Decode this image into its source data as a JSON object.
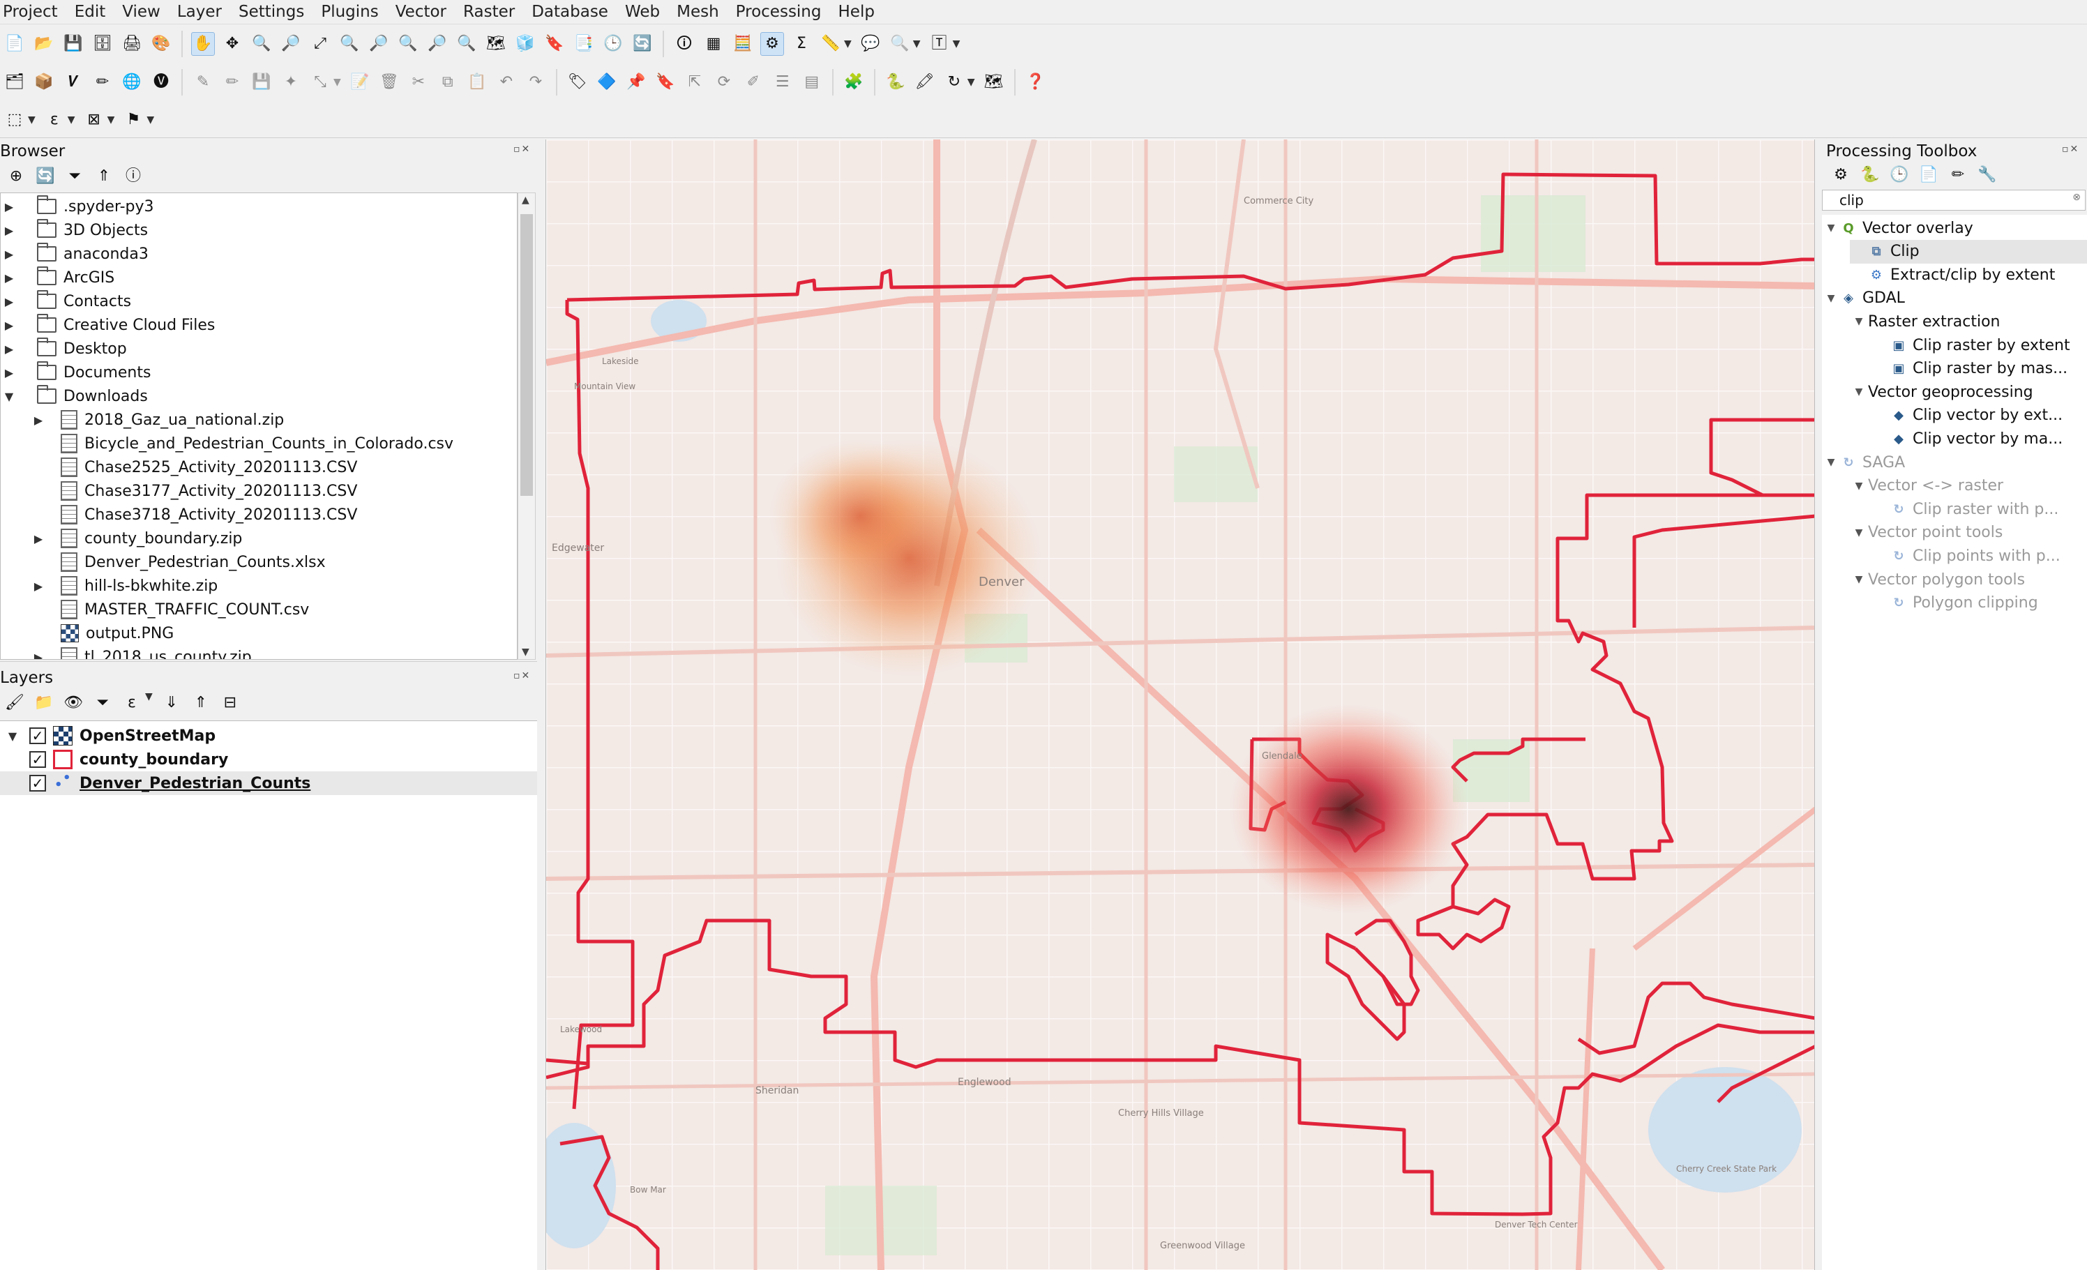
{
  "menu": [
    "Project",
    "Edit",
    "View",
    "Layer",
    "Settings",
    "Plugins",
    "Vector",
    "Raster",
    "Database",
    "Web",
    "Mesh",
    "Processing",
    "Help"
  ],
  "browser": {
    "title": "Browser",
    "items": [
      {
        "label": ".spyder-py3",
        "kind": "folder",
        "expanded": false
      },
      {
        "label": "3D Objects",
        "kind": "folder",
        "expanded": false
      },
      {
        "label": "anaconda3",
        "kind": "folder",
        "expanded": false
      },
      {
        "label": "ArcGIS",
        "kind": "folder",
        "expanded": false
      },
      {
        "label": "Contacts",
        "kind": "folder",
        "expanded": false
      },
      {
        "label": "Creative Cloud Files",
        "kind": "folder",
        "expanded": false
      },
      {
        "label": "Desktop",
        "kind": "folder",
        "expanded": false
      },
      {
        "label": "Documents",
        "kind": "folder",
        "expanded": false
      },
      {
        "label": "Downloads",
        "kind": "folder",
        "expanded": true
      },
      {
        "label": "2018_Gaz_ua_national.zip",
        "kind": "zip",
        "expanded": false
      },
      {
        "label": "Bicycle_and_Pedestrian_Counts_in_Colorado.csv",
        "kind": "file"
      },
      {
        "label": "Chase2525_Activity_20201113.CSV",
        "kind": "file"
      },
      {
        "label": "Chase3177_Activity_20201113.CSV",
        "kind": "file"
      },
      {
        "label": "Chase3718_Activity_20201113.CSV",
        "kind": "file"
      },
      {
        "label": "county_boundary.zip",
        "kind": "zip",
        "expanded": false
      },
      {
        "label": "Denver_Pedestrian_Counts.xlsx",
        "kind": "file"
      },
      {
        "label": "hill-ls-bkwhite.zip",
        "kind": "zip",
        "expanded": false
      },
      {
        "label": "MASTER_TRAFFIC_COUNT.csv",
        "kind": "file"
      },
      {
        "label": "output.PNG",
        "kind": "png"
      },
      {
        "label": "tl_2018_us_county.zip",
        "kind": "zip",
        "expanded": false
      }
    ]
  },
  "layers": {
    "title": "Layers",
    "items": [
      {
        "label": "OpenStreetMap",
        "checked": true,
        "icon": "raster-tile-icon"
      },
      {
        "label": "county_boundary",
        "checked": true,
        "icon": "polygon-layer-icon"
      },
      {
        "label": "Denver_Pedestrian_Counts",
        "checked": true,
        "icon": "point-layer-icon",
        "selected": true
      }
    ]
  },
  "toolbox": {
    "title": "Processing Toolbox",
    "search_value": "clip",
    "items": [
      {
        "label": "Vector overlay",
        "level": 0,
        "icon": "qgis-icon",
        "expanded": true
      },
      {
        "label": "Clip",
        "level": 1,
        "icon": "clip-algorithm-icon",
        "selected": true
      },
      {
        "label": "Extract/clip by extent",
        "level": 1,
        "icon": "gear-icon"
      },
      {
        "label": "GDAL",
        "level": 0,
        "icon": "gdal-icon",
        "expanded": true
      },
      {
        "label": "Raster extraction",
        "level": 1,
        "expanded": true
      },
      {
        "label": "Clip raster by extent",
        "level": 2,
        "icon": "gdal-raster-icon"
      },
      {
        "label": "Clip raster by mas...",
        "level": 2,
        "icon": "gdal-raster-icon"
      },
      {
        "label": "Vector geoprocessing",
        "level": 1,
        "expanded": true
      },
      {
        "label": "Clip vector by ext...",
        "level": 2,
        "icon": "gdal-vector-icon"
      },
      {
        "label": "Clip vector by ma...",
        "level": 2,
        "icon": "gdal-vector-icon"
      },
      {
        "label": "SAGA",
        "level": 0,
        "icon": "saga-icon",
        "expanded": true,
        "disabled": true
      },
      {
        "label": "Vector <-> raster",
        "level": 1,
        "expanded": true,
        "disabled": true
      },
      {
        "label": "Clip raster with p...",
        "level": 2,
        "icon": "saga-icon",
        "disabled": true
      },
      {
        "label": "Vector point tools",
        "level": 1,
        "expanded": true,
        "disabled": true
      },
      {
        "label": "Clip points with p...",
        "level": 2,
        "icon": "saga-icon",
        "disabled": true
      },
      {
        "label": "Vector polygon tools",
        "level": 1,
        "expanded": true,
        "disabled": true
      },
      {
        "label": "Polygon clipping",
        "level": 2,
        "icon": "saga-icon",
        "disabled": true
      }
    ]
  },
  "map": {
    "labels": [
      "Denver",
      "Edgewater",
      "Englewood",
      "Sheridan",
      "Glendale",
      "Cherry Hills Village",
      "Greenwood Village",
      "Commerce City",
      "Lakeside",
      "Mountain View",
      "Cherry Creek State Park",
      "Denver Tech Center",
      "Bow Mar",
      "Lakewood"
    ],
    "boundary_color": "#e0233a",
    "heat_color": "#e0482a"
  }
}
